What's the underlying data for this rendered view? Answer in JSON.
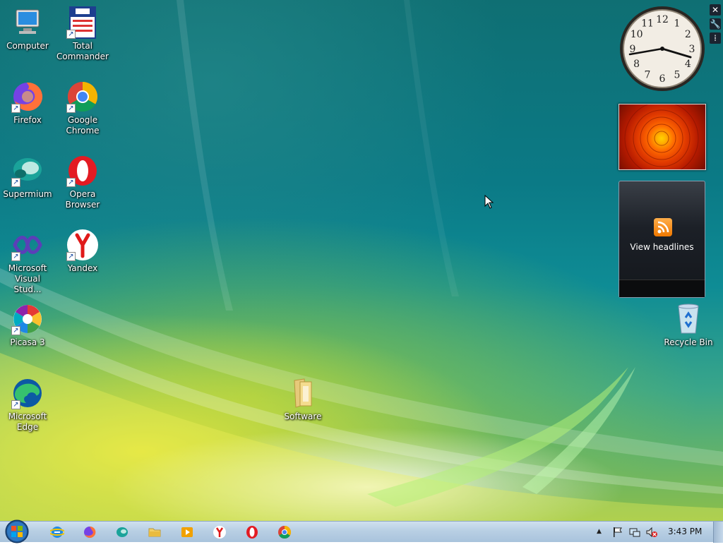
{
  "desktop": {
    "icons": [
      {
        "name": "computer",
        "label": "Computer",
        "icon": "computer-icon"
      },
      {
        "name": "total-commander",
        "label": "Total\nCommander",
        "icon": "total-commander-icon"
      },
      {
        "name": "firefox",
        "label": "Firefox",
        "icon": "firefox-icon"
      },
      {
        "name": "google-chrome",
        "label": "Google\nChrome",
        "icon": "chrome-icon"
      },
      {
        "name": "supermium",
        "label": "Supermium",
        "icon": "supermium-icon"
      },
      {
        "name": "opera-browser",
        "label": "Opera\nBrowser",
        "icon": "opera-icon"
      },
      {
        "name": "microsoft-visual-studio",
        "label": "Microsoft\nVisual Stud...",
        "icon": "visual-studio-icon"
      },
      {
        "name": "yandex",
        "label": "Yandex",
        "icon": "yandex-icon"
      },
      {
        "name": "picasa-3",
        "label": "Picasa 3",
        "icon": "picasa-icon"
      },
      {
        "name": "microsoft-edge",
        "label": "Microsoft\nEdge",
        "icon": "edge-icon"
      },
      {
        "name": "software-folder",
        "label": "Software",
        "icon": "folder-icon"
      },
      {
        "name": "recycle-bin",
        "label": "Recycle Bin",
        "icon": "recycle-bin-icon"
      }
    ]
  },
  "gadgets": {
    "clock": {
      "hour_labels": [
        "12",
        "1",
        "2",
        "3",
        "4",
        "5",
        "6",
        "7",
        "8",
        "9",
        "10",
        "11"
      ]
    },
    "feed": {
      "label": "View headlines"
    },
    "tools": [
      "close-icon",
      "wrench-icon",
      "grip-icon"
    ]
  },
  "taskbar": {
    "pinned": [
      "internet-explorer-icon",
      "firefox-icon",
      "supermium-icon",
      "file-explorer-icon",
      "media-player-icon",
      "yandex-icon",
      "opera-icon",
      "chrome-icon"
    ],
    "tray": [
      "action-center-flag-icon",
      "network-icon",
      "volume-muted-icon"
    ],
    "time": "3:43 PM"
  }
}
